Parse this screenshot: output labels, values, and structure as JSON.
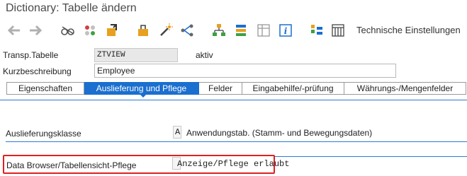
{
  "window": {
    "title": "Dictionary: Tabelle ändern"
  },
  "toolbar": {
    "technical_settings": "Technische Einstellungen"
  },
  "header": {
    "table_label": "Transp.Tabelle",
    "table_value": "ZTVIEW",
    "status": "aktiv",
    "short_desc_label": "Kurzbeschreibung",
    "short_desc_value": "Employee"
  },
  "tabs": [
    {
      "label": "Eigenschaften",
      "active": false
    },
    {
      "label": "Auslieferung und Pflege",
      "active": true
    },
    {
      "label": "Felder",
      "active": false
    },
    {
      "label": "Eingabehilfe/-prüfung",
      "active": false
    },
    {
      "label": "Währungs-/Mengenfelder",
      "active": false
    }
  ],
  "delivery": {
    "class_label": "Auslieferungsklasse",
    "class_key": "A",
    "class_text": "Anwendungstab. (Stamm- und Bewegungsdaten)",
    "maint_label": "Data Browser/Tabellensicht-Pflege",
    "maint_value": "Anzeige/Pflege erlaubt"
  },
  "colors": {
    "accent": "#1a6fcf",
    "highlight": "#e02020"
  }
}
